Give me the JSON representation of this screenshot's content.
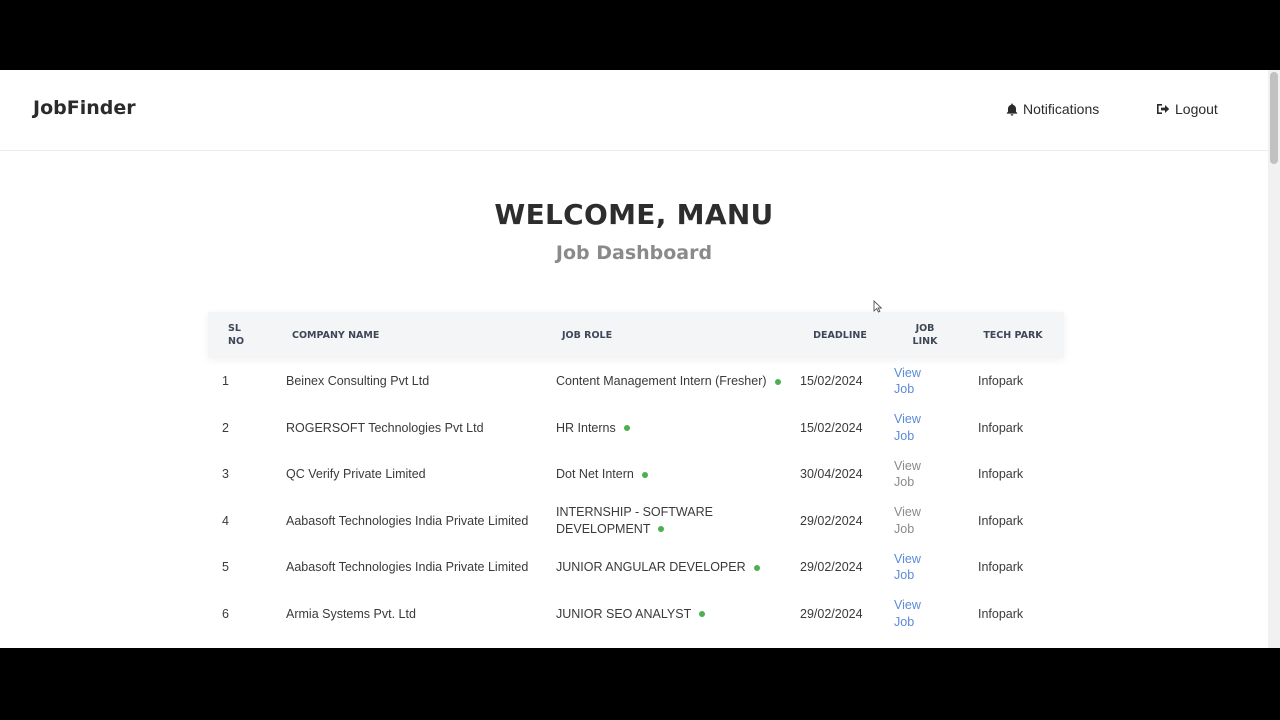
{
  "navbar": {
    "brand": "JobFinder",
    "notifications_label": "Notifications",
    "logout_label": "Logout"
  },
  "header": {
    "welcome": "WELCOME, MANU",
    "subtitle": "Job Dashboard"
  },
  "table": {
    "columns": {
      "sl_no": "SL NO",
      "company": "COMPANY NAME",
      "role": "JOB ROLE",
      "deadline": "DEADLINE",
      "link": "JOB LINK",
      "park": "TECH PARK"
    },
    "rows": [
      {
        "sl": "1",
        "company": "Beinex Consulting Pvt Ltd",
        "role": "Content Management Intern (Fresher)",
        "deadline": "15/02/2024",
        "link": "View Job",
        "link_state": "active",
        "park": "Infopark"
      },
      {
        "sl": "2",
        "company": "ROGERSOFT Technologies Pvt Ltd",
        "role": "HR Interns",
        "deadline": "15/02/2024",
        "link": "View Job",
        "link_state": "active",
        "park": "Infopark"
      },
      {
        "sl": "3",
        "company": "QC Verify Private Limited",
        "role": "Dot Net Intern",
        "deadline": "30/04/2024",
        "link": "View Job",
        "link_state": "visited",
        "park": "Infopark"
      },
      {
        "sl": "4",
        "company": "Aabasoft Technologies India Private Limited",
        "role": "INTERNSHIP - SOFTWARE DEVELOPMENT",
        "deadline": "29/02/2024",
        "link": "View Job",
        "link_state": "visited",
        "park": "Infopark"
      },
      {
        "sl": "5",
        "company": "Aabasoft Technologies India Private Limited",
        "role": "JUNIOR ANGULAR DEVELOPER",
        "deadline": "29/02/2024",
        "link": "View Job",
        "link_state": "active",
        "park": "Infopark"
      },
      {
        "sl": "6",
        "company": "Armia Systems Pvt. Ltd",
        "role": "JUNIOR SEO ANALYST",
        "deadline": "29/02/2024",
        "link": "View Job",
        "link_state": "active",
        "park": "Infopark"
      }
    ]
  },
  "colors": {
    "link_active": "#5b8bd9",
    "link_visited": "#8a8a8a",
    "status_dot": "#4caf50"
  },
  "icons": {
    "notifications": "bell-icon",
    "logout": "sign-out-icon",
    "status": "green-dot-icon"
  }
}
